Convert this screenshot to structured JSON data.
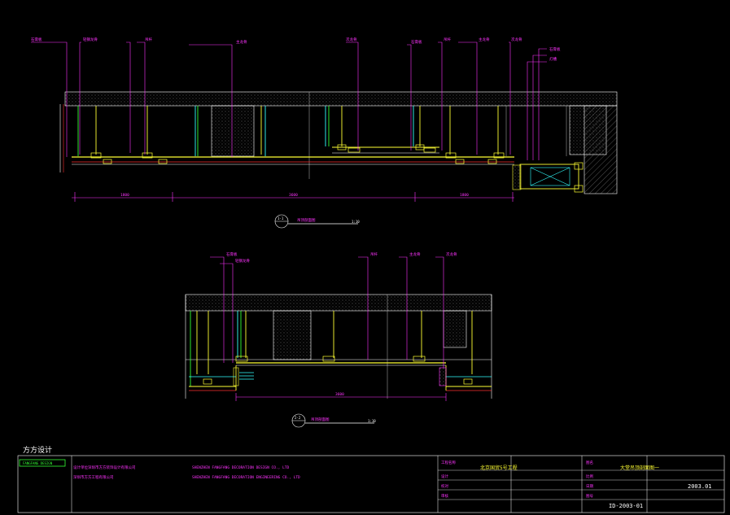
{
  "section_1": {
    "title": "吊顶剖面图",
    "scale": "1:10",
    "index": "1-1"
  },
  "section_2": {
    "title": "吊顶剖面图",
    "scale": "1:10",
    "index": "2-2"
  },
  "callouts_top": [
    "石膏板",
    "轻钢龙骨",
    "吊杆",
    "主龙骨",
    "次龙骨",
    "石膏板",
    "吊杆",
    "主龙骨",
    "次龙骨",
    "石膏板",
    "灯槽"
  ],
  "callouts_bottom": [
    "石膏板",
    "轻钢龙骨",
    "吊杆",
    "主龙骨",
    "次龙骨"
  ],
  "dims_top": [
    "1800",
    "3600",
    "1800"
  ],
  "dims_bottom": [
    "3600"
  ],
  "title_block": {
    "firm_name": "方方设计",
    "firm_sub": "FANGFANG DESIGN",
    "company_label": "设计单位",
    "company_name": "深圳市方方装饰设计有限公司",
    "company_name_en": "SHENZHEN FANGFANG DECORATION DESIGN CO., LTD",
    "client_name": "深圳市方方工程有限公司",
    "client_name_en": "SHENZHEN FANGFANG DECORATION ENGINEERING CO., LTD",
    "project_label": "工程名称",
    "project_name": "北京国贸5号工程",
    "drawing_label": "图名",
    "drawing_name": "大堂吊顶剖面图一",
    "date": "2003.01",
    "drawing_no": "ID-2003-01",
    "row_labels": [
      "设计",
      "校对",
      "审核",
      "图号",
      "比例",
      "日期"
    ]
  }
}
